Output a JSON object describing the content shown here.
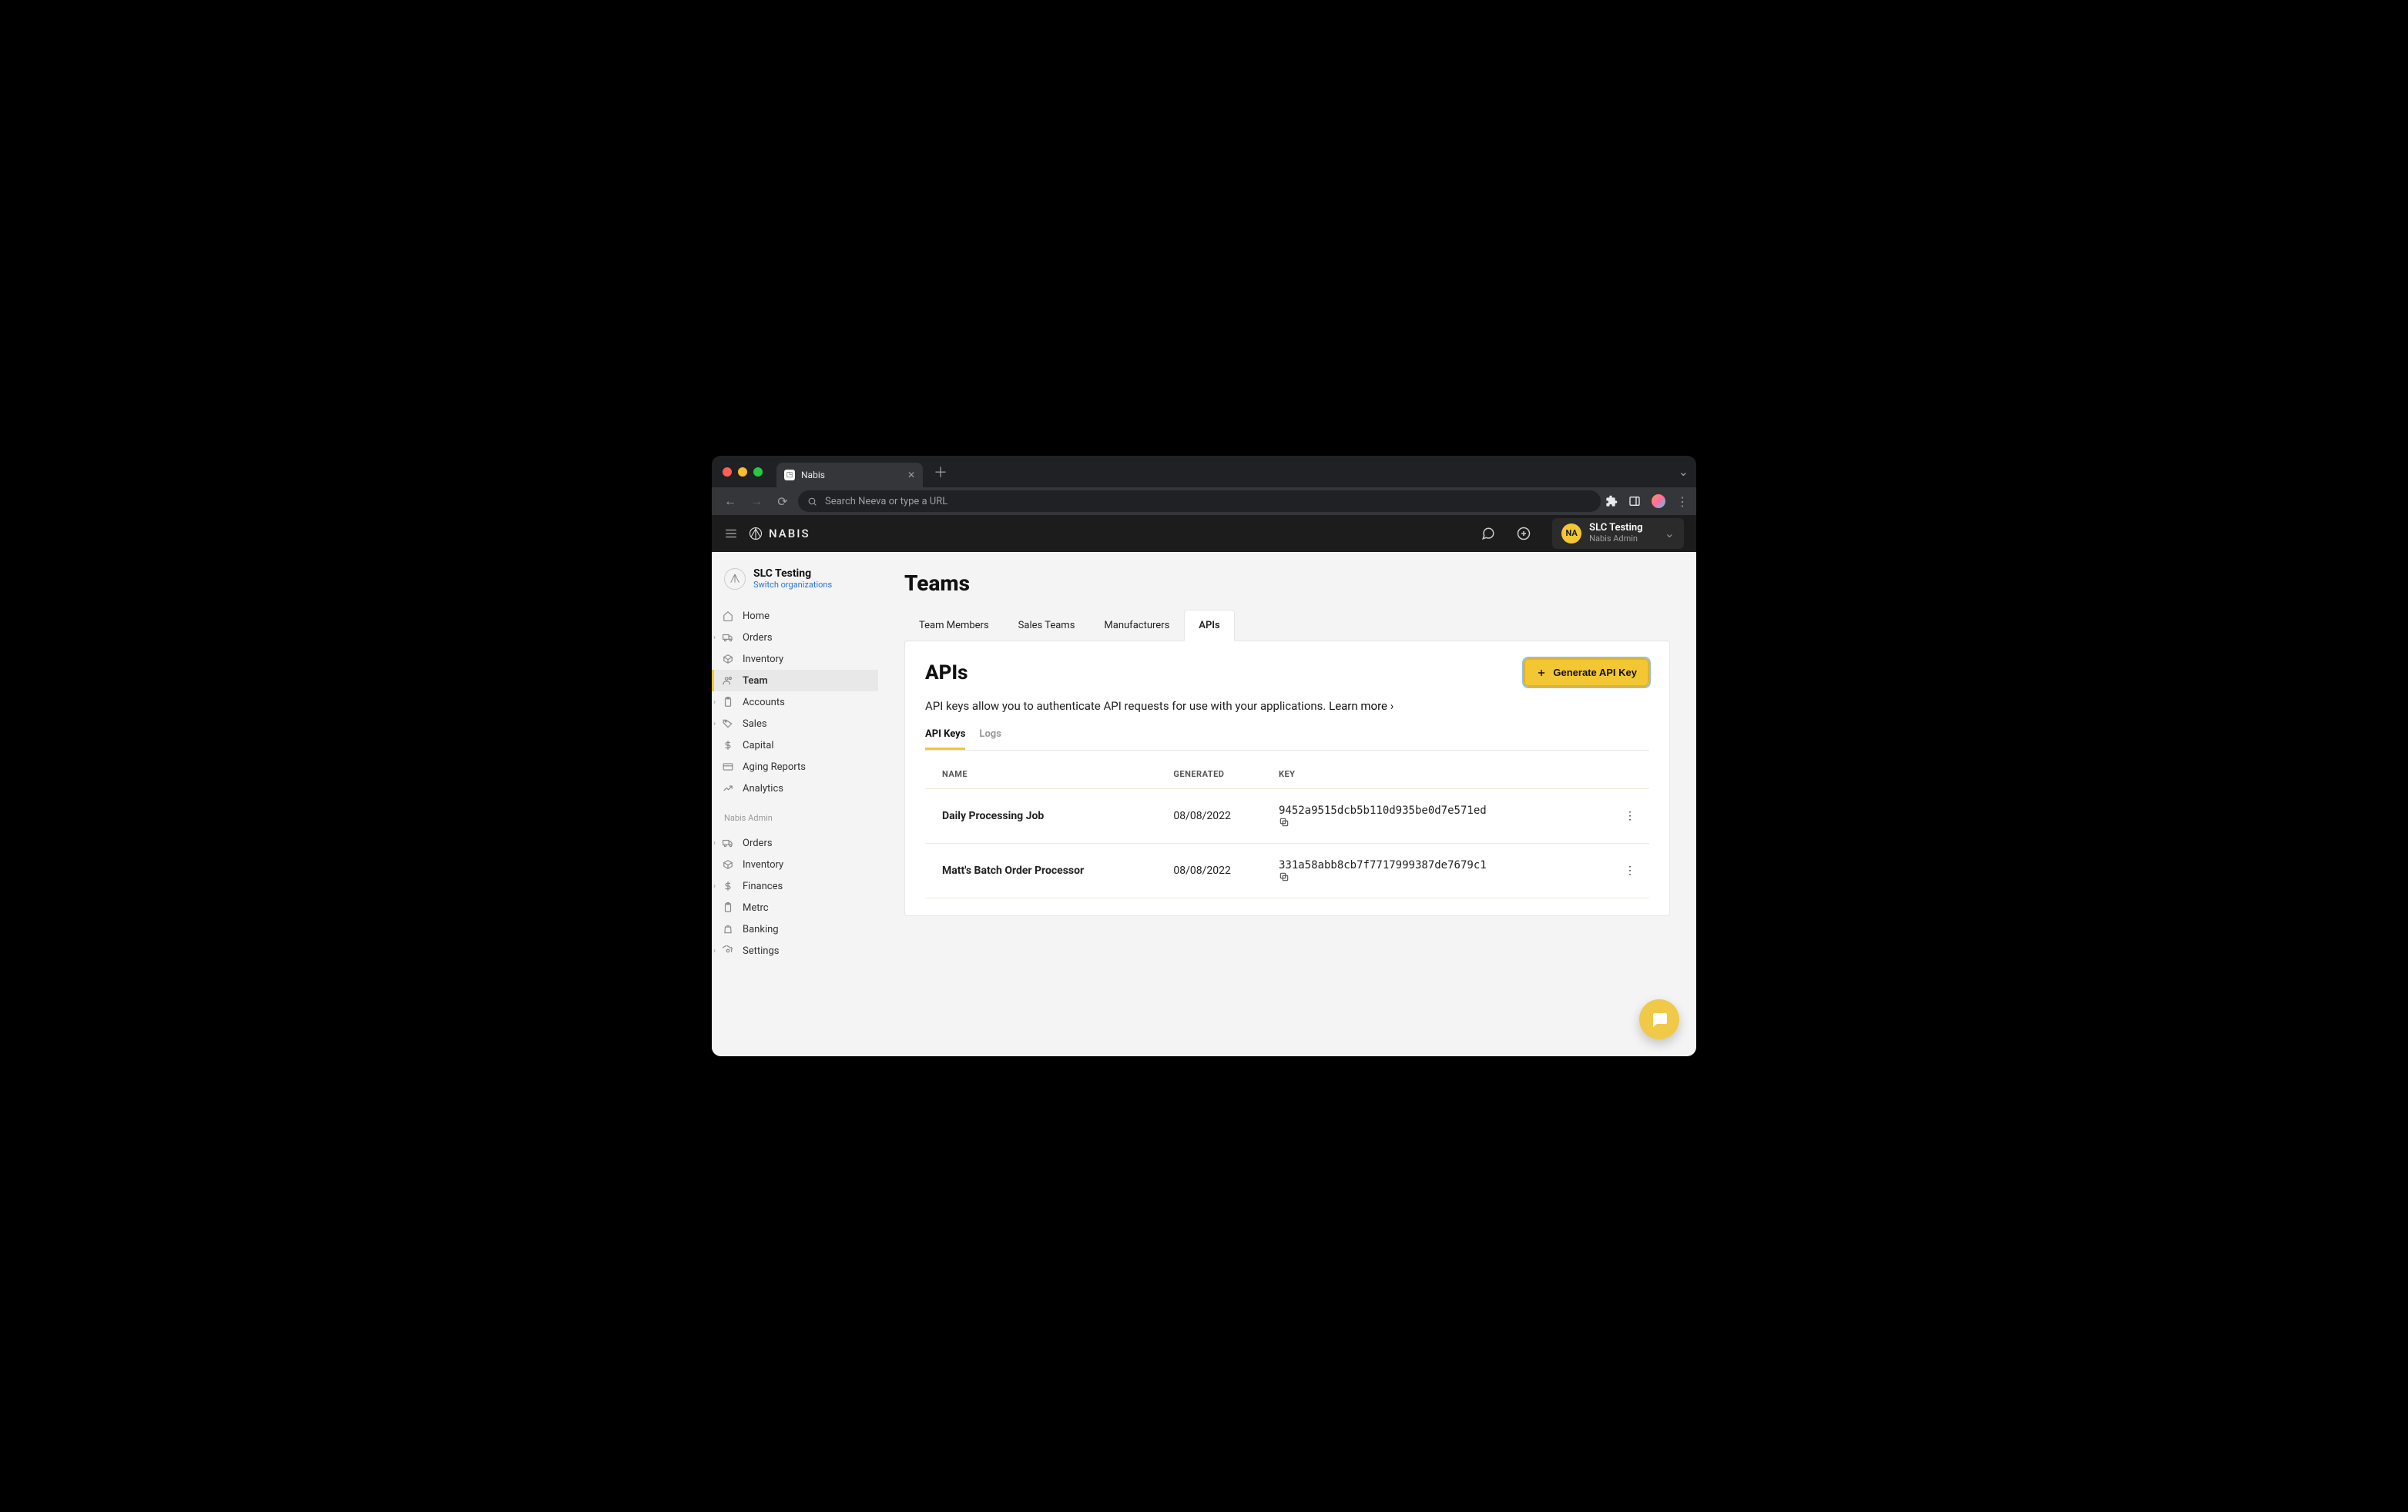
{
  "browser": {
    "tab_title": "Nabis",
    "search_placeholder": "Search Neeva or type a URL"
  },
  "header": {
    "brand": "NABIS",
    "org_badge": "NA",
    "org_name": "SLC Testing",
    "org_role": "Nabis Admin"
  },
  "sidebar": {
    "org_name": "SLC Testing",
    "switch_label": "Switch organizations",
    "primary": [
      {
        "label": "Home",
        "icon": "home",
        "expandable": false
      },
      {
        "label": "Orders",
        "icon": "truck",
        "expandable": true
      },
      {
        "label": "Inventory",
        "icon": "box",
        "expandable": false
      },
      {
        "label": "Team",
        "icon": "users",
        "expandable": false,
        "active": true
      },
      {
        "label": "Accounts",
        "icon": "clipboard",
        "expandable": true
      },
      {
        "label": "Sales",
        "icon": "tag",
        "expandable": true
      },
      {
        "label": "Capital",
        "icon": "dollar",
        "expandable": false
      },
      {
        "label": "Aging Reports",
        "icon": "card",
        "expandable": false
      },
      {
        "label": "Analytics",
        "icon": "trend",
        "expandable": false
      }
    ],
    "admin_title": "Nabis Admin",
    "admin": [
      {
        "label": "Orders",
        "icon": "truck",
        "expandable": true
      },
      {
        "label": "Inventory",
        "icon": "box",
        "expandable": false
      },
      {
        "label": "Finances",
        "icon": "dollar",
        "expandable": true
      },
      {
        "label": "Metrc",
        "icon": "clipboard",
        "expandable": false
      },
      {
        "label": "Banking",
        "icon": "bag",
        "expandable": false
      },
      {
        "label": "Settings",
        "icon": "gear",
        "expandable": true
      }
    ]
  },
  "page": {
    "title": "Teams",
    "tabs": [
      "Team Members",
      "Sales Teams",
      "Manufacturers",
      "APIs"
    ],
    "active_tab": "APIs",
    "section_title": "APIs",
    "generate_label": "Generate API Key",
    "description": "API keys allow you to authenticate API requests for use with your applications.",
    "learn_more": "Learn more",
    "subtabs": [
      "API Keys",
      "Logs"
    ],
    "active_subtab": "API Keys",
    "columns": {
      "name": "NAME",
      "generated": "GENERATED",
      "key": "KEY"
    },
    "keys": [
      {
        "name": "Daily Processing Job",
        "generated": "08/08/2022",
        "key": "9452a9515dcb5b110d935be0d7e571ed"
      },
      {
        "name": "Matt's Batch Order Processor",
        "generated": "08/08/2022",
        "key": "331a58abb8cb7f7717999387de7679c1"
      }
    ]
  },
  "colors": {
    "accent": "#f3c634",
    "bg": "#f4f4f4",
    "panel": "#ffffff"
  }
}
